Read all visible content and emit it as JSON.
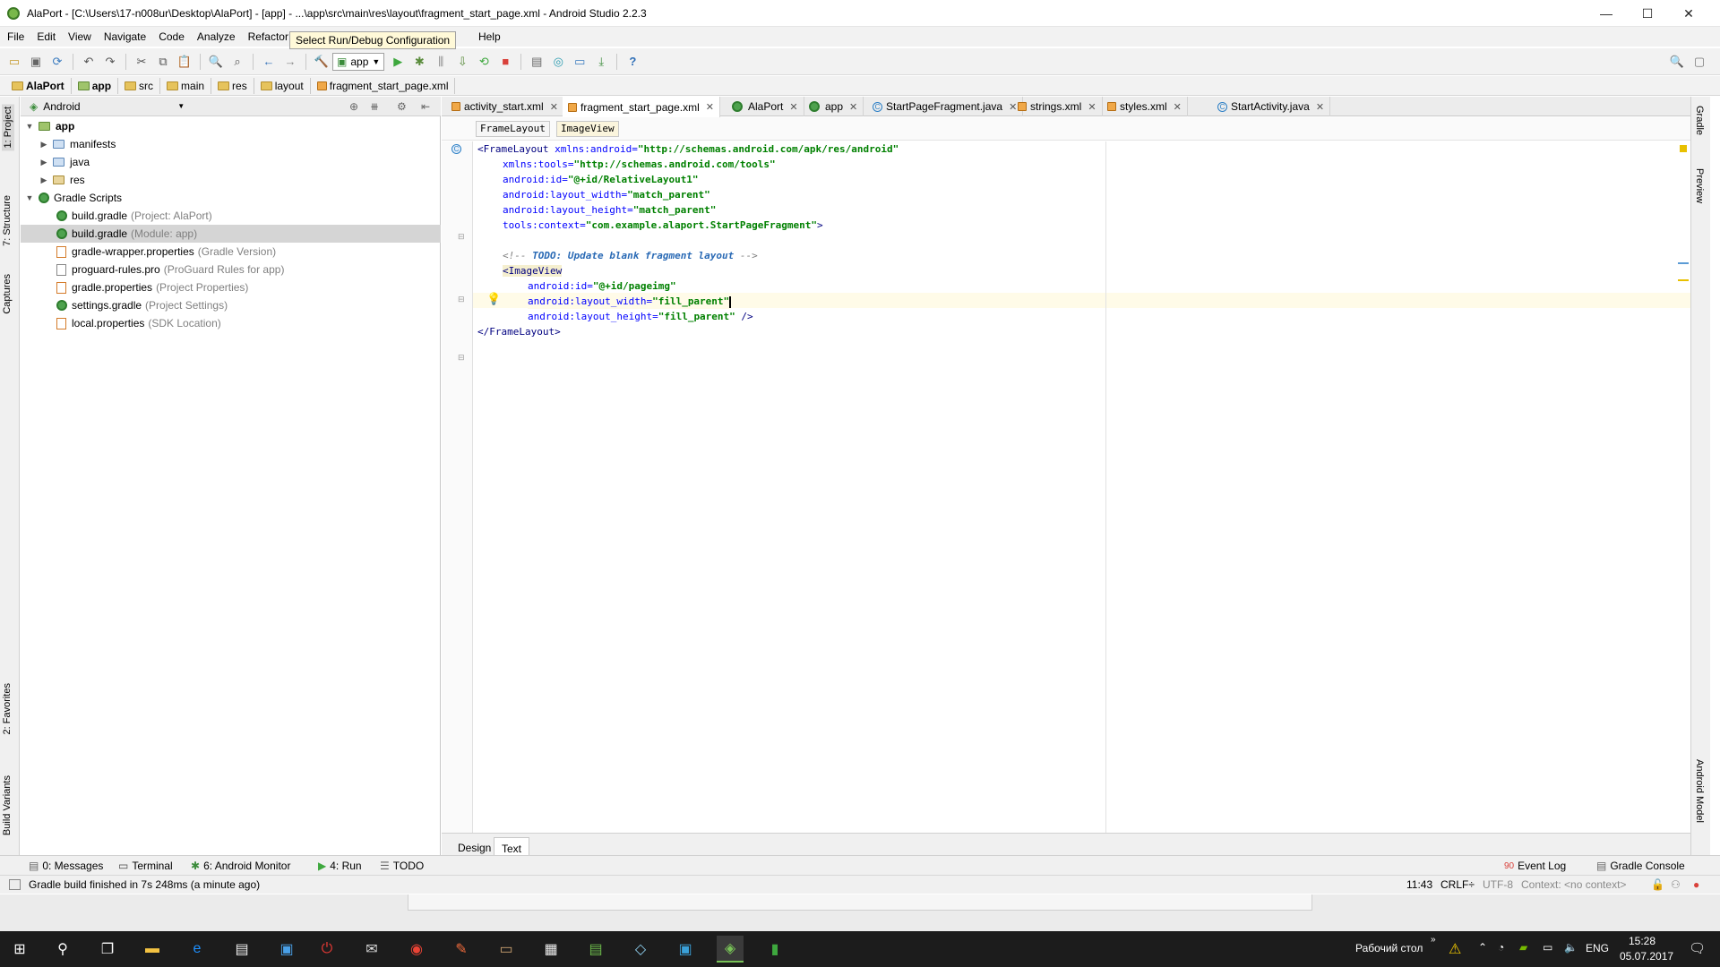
{
  "window": {
    "title": "AlaPort - [C:\\Users\\17-n008ur\\Desktop\\AlaPort] - [app] - ...\\app\\src\\main\\res\\layout\\fragment_start_page.xml - Android Studio 2.2.3",
    "minimize": "—",
    "maximize": "☐",
    "close": "✕"
  },
  "menu": [
    "File",
    "Edit",
    "View",
    "Navigate",
    "Code",
    "Analyze",
    "Refactor",
    "B",
    "Help"
  ],
  "tooltip": "Select Run/Debug Configuration",
  "toolbar": {
    "run_config": "app"
  },
  "navbar": [
    "AlaPort",
    "app",
    "src",
    "main",
    "res",
    "layout",
    "fragment_start_page.xml"
  ],
  "project": {
    "view": "Android",
    "tree": [
      {
        "name": "app",
        "hint": ""
      },
      {
        "name": "manifests",
        "hint": ""
      },
      {
        "name": "java",
        "hint": ""
      },
      {
        "name": "res",
        "hint": ""
      },
      {
        "name": "Gradle Scripts",
        "hint": ""
      },
      {
        "name": "build.gradle",
        "hint": "(Project: AlaPort)"
      },
      {
        "name": "build.gradle",
        "hint": "(Module: app)"
      },
      {
        "name": "gradle-wrapper.properties",
        "hint": "(Gradle Version)"
      },
      {
        "name": "proguard-rules.pro",
        "hint": "(ProGuard Rules for app)"
      },
      {
        "name": "gradle.properties",
        "hint": "(Project Properties)"
      },
      {
        "name": "settings.gradle",
        "hint": "(Project Settings)"
      },
      {
        "name": "local.properties",
        "hint": "(SDK Location)"
      }
    ]
  },
  "tabs": [
    "activity_start.xml",
    "fragment_start_page.xml",
    "AlaPort",
    "app",
    "StartPageFragment.java",
    "strings.xml",
    "styles.xml",
    "StartActivity.java"
  ],
  "xml_breadcrumbs": [
    "FrameLayout",
    "ImageView"
  ],
  "code": {
    "l1_tag": "<FrameLayout",
    "l1_attr": " xmlns:android=",
    "l1_val": "\"http://schemas.android.com/apk/res/android\"",
    "l2_attr": "xmlns:tools=",
    "l2_val": "\"http://schemas.android.com/tools\"",
    "l3_attr": "android:id=",
    "l3_val": "\"@+id/RelativeLayout1\"",
    "l4_attr": "android:layout_width=",
    "l4_val": "\"match_parent\"",
    "l5_attr": "android:layout_height=",
    "l5_val": "\"match_parent\"",
    "l6_attr": "tools:context=",
    "l6_val": "\"com.example.alaport.StartPageFragment\"",
    "l6_end": ">",
    "c_open": "<!-- ",
    "c_todo": "TODO: Update blank fragment layout",
    "c_close": " -->",
    "l9_tag": "<ImageView",
    "l10_attr": "android:id=",
    "l10_val": "\"@+id/pageimg\"",
    "l11_attr": "android:layout_width=",
    "l11_val": "\"fill_parent\"",
    "l12_attr": "android:layout_height=",
    "l12_val": "\"fill_parent\"",
    "l12_end": " />",
    "l13_tag": "</FrameLayout>"
  },
  "editor_bottom_tabs": [
    "Design",
    "Text"
  ],
  "tool_windows": {
    "messages": "0: Messages",
    "terminal": "Terminal",
    "monitor": "6: Android Monitor",
    "run": "4: Run",
    "todo": "TODO",
    "event_log_count": "90",
    "event_log": "Event Log",
    "gradle_console": "Gradle Console"
  },
  "side_tools": {
    "project": "1: Project",
    "structure": "7: Structure",
    "captures": "Captures",
    "favorites": "2: Favorites",
    "build_variants": "Build Variants",
    "gradle": "Gradle",
    "preview": "Preview",
    "android_model": "Android Model"
  },
  "status": {
    "message": "Gradle build finished in 7s 248ms (a minute ago)",
    "position": "11:43",
    "line_sep": "CRLF÷",
    "encoding": "UTF-8",
    "context": "Context: <no context>"
  },
  "taskbar": {
    "desktop_label": "Рабочий стол",
    "lang": "ENG",
    "time": "15:28",
    "date": "05.07.2017"
  },
  "colors": {
    "xml_tag": "#000080",
    "xml_attr": "#0000ff",
    "xml_value": "#008000",
    "comment": "#808080",
    "todo": "#2a6ab5",
    "current_line": "#fffbe8"
  }
}
